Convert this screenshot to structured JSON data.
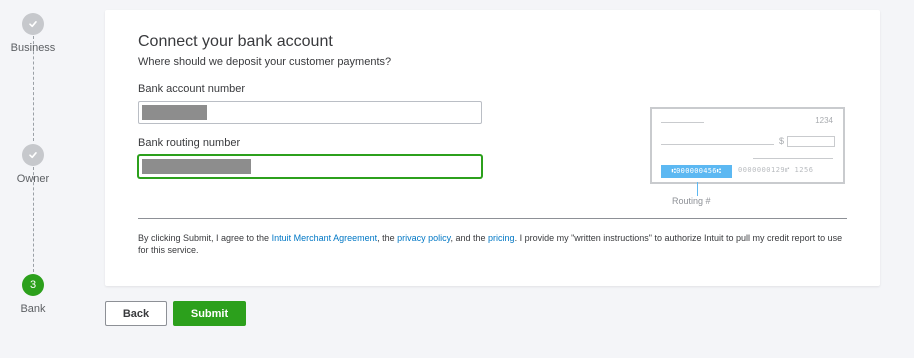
{
  "stepper": {
    "steps": [
      {
        "label": "Business",
        "state": "done",
        "icon": "checkmark-icon"
      },
      {
        "label": "Owner",
        "state": "done",
        "icon": "checkmark-icon"
      },
      {
        "label": "Bank",
        "state": "active",
        "number": "3"
      }
    ]
  },
  "form": {
    "title": "Connect your bank account",
    "subtitle": "Where should we deposit your customer payments?",
    "account_label": "Bank account number",
    "routing_label": "Bank routing number"
  },
  "check_illustration": {
    "check_number": "1234",
    "dollar_sign": "$",
    "routing_digits": "⑆000000456⑆",
    "account_digits": "0000000129⑈ 1256",
    "routing_caption": "Routing #"
  },
  "legal": {
    "part1": "By clicking Submit, I agree to the ",
    "link_merchant": "Intuit Merchant Agreement",
    "part2": ", the ",
    "link_privacy": "privacy policy",
    "part3": ", and the ",
    "link_pricing": "pricing",
    "part4": ". I provide my \"written instructions\" to authorize Intuit to pull my credit report to use for this service."
  },
  "buttons": {
    "back": "Back",
    "submit": "Submit"
  },
  "colors": {
    "brand_green": "#2ca01c",
    "link_blue": "#0077c5",
    "highlight_blue": "#5cb8f2"
  }
}
